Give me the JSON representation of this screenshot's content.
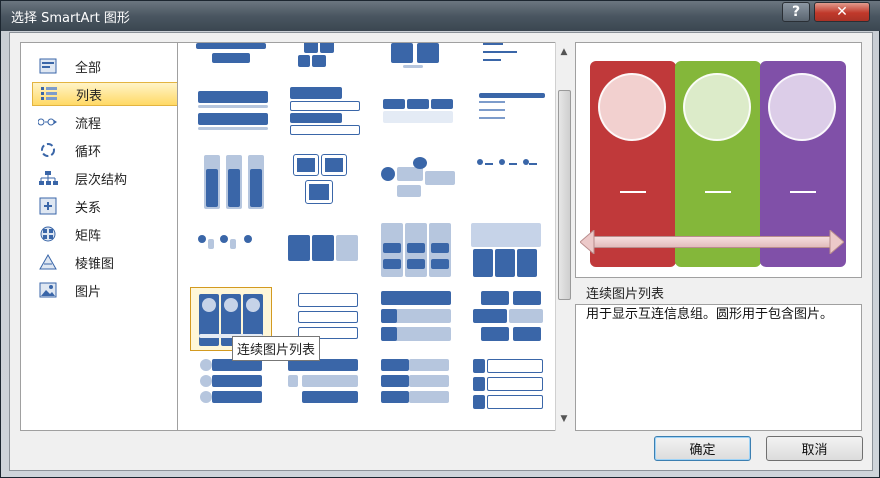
{
  "window": {
    "title": "选择 SmartArt 图形",
    "help_label": "?",
    "close_label": "✕"
  },
  "categories": [
    {
      "label": "全部",
      "icon": "all-icon",
      "selected": false
    },
    {
      "label": "列表",
      "icon": "list-icon",
      "selected": true
    },
    {
      "label": "流程",
      "icon": "process-icon",
      "selected": false
    },
    {
      "label": "循环",
      "icon": "cycle-icon",
      "selected": false
    },
    {
      "label": "层次结构",
      "icon": "hierarchy-icon",
      "selected": false
    },
    {
      "label": "关系",
      "icon": "relationship-icon",
      "selected": false
    },
    {
      "label": "矩阵",
      "icon": "matrix-icon",
      "selected": false
    },
    {
      "label": "棱锥图",
      "icon": "pyramid-icon",
      "selected": false
    },
    {
      "label": "图片",
      "icon": "picture-icon",
      "selected": false
    }
  ],
  "gallery": {
    "tooltip": "连续图片列表",
    "selected_index": 16
  },
  "preview": {
    "name": "连续图片列表",
    "description": "用于显示互连信息组。圆形用于包含图片。",
    "colors": [
      "#c0393a",
      "#84b73a",
      "#8050a8"
    ]
  },
  "buttons": {
    "ok": "确定",
    "cancel": "取消"
  }
}
